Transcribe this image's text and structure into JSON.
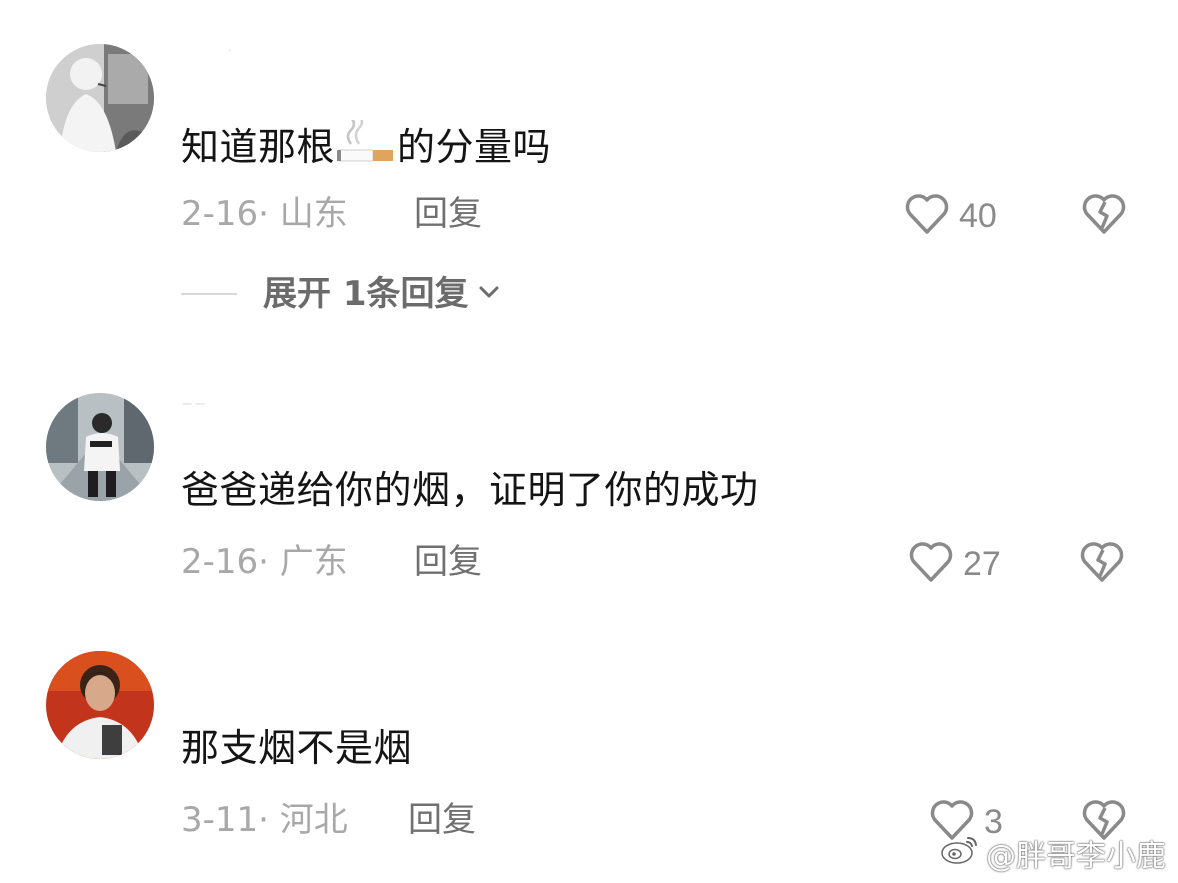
{
  "comments": [
    {
      "username": "·",
      "avatar": "avatar-photo-monochrome",
      "text_before": "知道那根",
      "emoji": "cigarette-emoji",
      "text_after": "的分量吗",
      "date_location": "2-16· 山东",
      "reply_label": "回复",
      "likes": "40",
      "expand_label": "展开 1条回复"
    },
    {
      "username": "一  一",
      "avatar": "avatar-photo-street",
      "text": "爸爸递给你的烟，证明了你的成功",
      "date_location": "2-16· 广东",
      "reply_label": "回复",
      "likes": "27"
    },
    {
      "username": "",
      "avatar": "avatar-photo-portrait",
      "text": "那支烟不是烟",
      "date_location": "3-11· 河北",
      "reply_label": "回复",
      "likes": "3"
    }
  ],
  "icons": {
    "like": "heart-outline-icon",
    "dislike": "broken-heart-icon",
    "expand": "chevron-down-icon"
  },
  "watermark": {
    "logo": "weibo-logo",
    "text": "@胖哥李小鹿"
  },
  "colors": {
    "primary_text": "#141414",
    "meta_text": "#a8a8a8",
    "icon_gray": "#8a8a8a",
    "background": "#ffffff"
  }
}
